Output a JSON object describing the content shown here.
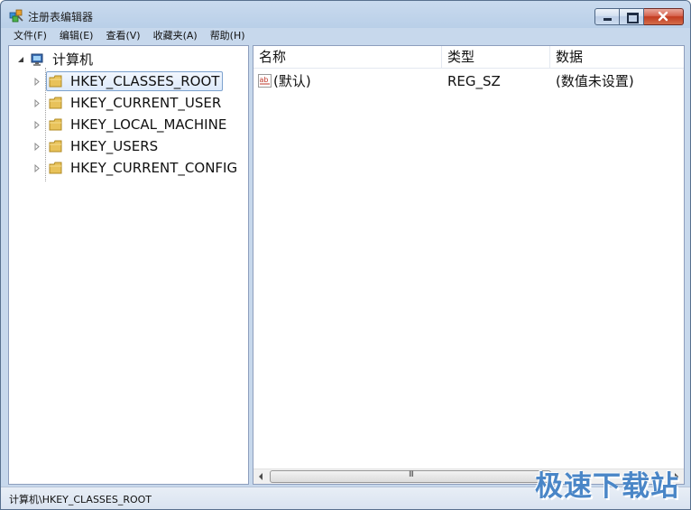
{
  "window": {
    "title": "注册表编辑器"
  },
  "menu": [
    {
      "label": "文件(F)"
    },
    {
      "label": "编辑(E)"
    },
    {
      "label": "查看(V)"
    },
    {
      "label": "收藏夹(A)"
    },
    {
      "label": "帮助(H)"
    }
  ],
  "tree": {
    "root": "计算机",
    "items": [
      {
        "label": "HKEY_CLASSES_ROOT",
        "selected": true
      },
      {
        "label": "HKEY_CURRENT_USER",
        "selected": false
      },
      {
        "label": "HKEY_LOCAL_MACHINE",
        "selected": false
      },
      {
        "label": "HKEY_USERS",
        "selected": false
      },
      {
        "label": "HKEY_CURRENT_CONFIG",
        "selected": false
      }
    ]
  },
  "list": {
    "columns": [
      "名称",
      "类型",
      "数据"
    ],
    "rows": [
      {
        "name": "(默认)",
        "type": "REG_SZ",
        "data": "(数值未设置)"
      }
    ]
  },
  "scrollbar": {
    "grip": "III"
  },
  "status": {
    "path": "计算机\\HKEY_CLASSES_ROOT"
  },
  "watermark": {
    "text": "极速下载站"
  },
  "colors": {
    "selection_border": "#7da2ce",
    "pane_border": "#8d9ebd",
    "close_button": "#c23b20",
    "watermark": "#4a86c7"
  }
}
